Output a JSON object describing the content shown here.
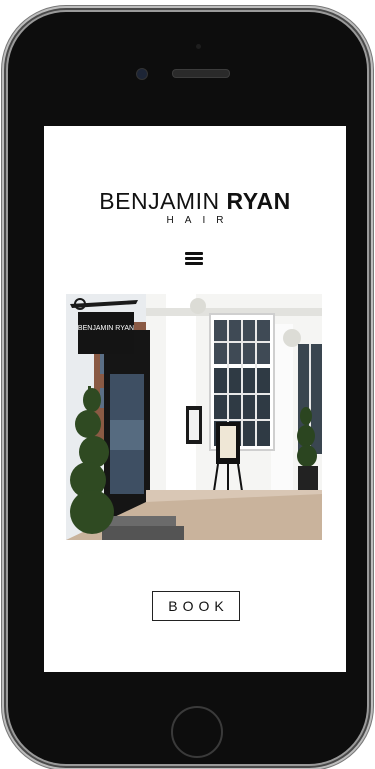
{
  "logo": {
    "name_light": "BENJAMIN",
    "name_bold": "RYAN",
    "tagline": "HAIR"
  },
  "nav": {
    "menu_icon": "hamburger-menu-icon"
  },
  "hero": {
    "sign_text": "BENJAMIN RYAN"
  },
  "cta": {
    "book_label": "BOOK"
  },
  "colors": {
    "phone_body": "#0d0d0d",
    "screen_background": "#ffffff",
    "text": "#111111"
  }
}
